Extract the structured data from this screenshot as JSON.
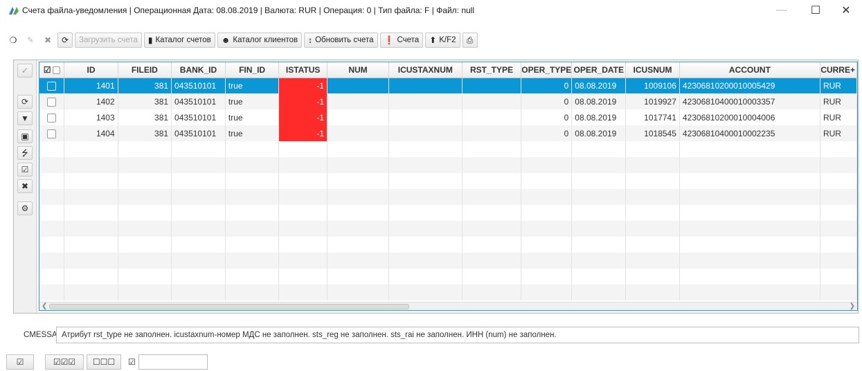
{
  "window": {
    "title": "Счета файла-уведомления | Операционная Дата: 08.08.2019  | Валюта: RUR | Операция: 0 | Тип файла: F | Файл: null"
  },
  "toolbar": {
    "load_accounts": "Загрузить счета",
    "account_catalog": "Каталог счетов",
    "client_catalog": "Каталог клиентов",
    "update_accounts": "Обновить счета",
    "accounts": "Счета",
    "kf2": "K/F2"
  },
  "table": {
    "columns": [
      "ID",
      "FILEID",
      "BANK_ID",
      "FIN_ID",
      "ISTATUS",
      "NUM",
      "ICUSTAXNUM",
      "RST_TYPE",
      "OPER_TYPE",
      "OPER_DATE",
      "ICUSNUM",
      "ACCOUNT",
      "CURRE"
    ],
    "rows": [
      {
        "id": "1401",
        "fileid": "381",
        "bank_id": "043510101",
        "fin_id": "true",
        "istatus": "-1",
        "num": "",
        "icustaxnum": "",
        "rst_type": "",
        "oper_type": "0",
        "oper_date": "08.08.2019",
        "icusnum": "1009106",
        "account": "42306810200010005429",
        "currency": "RUR"
      },
      {
        "id": "1402",
        "fileid": "381",
        "bank_id": "043510101",
        "fin_id": "true",
        "istatus": "-1",
        "num": "",
        "icustaxnum": "",
        "rst_type": "",
        "oper_type": "0",
        "oper_date": "08.08.2019",
        "icusnum": "1019927",
        "account": "42306810400010003357",
        "currency": "RUR"
      },
      {
        "id": "1403",
        "fileid": "381",
        "bank_id": "043510101",
        "fin_id": "true",
        "istatus": "-1",
        "num": "",
        "icustaxnum": "",
        "rst_type": "",
        "oper_type": "0",
        "oper_date": "08.08.2019",
        "icusnum": "1017741",
        "account": "42306810200010004006",
        "currency": "RUR"
      },
      {
        "id": "1404",
        "fileid": "381",
        "bank_id": "043510101",
        "fin_id": "true",
        "istatus": "-1",
        "num": "",
        "icustaxnum": "",
        "rst_type": "",
        "oper_type": "0",
        "oper_date": "08.08.2019",
        "icusnum": "1018545",
        "account": "42306810400010002235",
        "currency": "RUR"
      }
    ],
    "selected_row": 0
  },
  "message": {
    "label": "CMESSAGE",
    "value": "Атрибут rst_type не заполнен. icustaxnum-номер МДС не заполнен. sts_reg не заполнен. sts_rai не заполнен. ИНН (num) не заполнен."
  },
  "bottom": {
    "search_value": ""
  },
  "colors": {
    "selection": "#0b97d5",
    "error_status": "#ff2a2a",
    "grid_border": "#29a3d6"
  }
}
